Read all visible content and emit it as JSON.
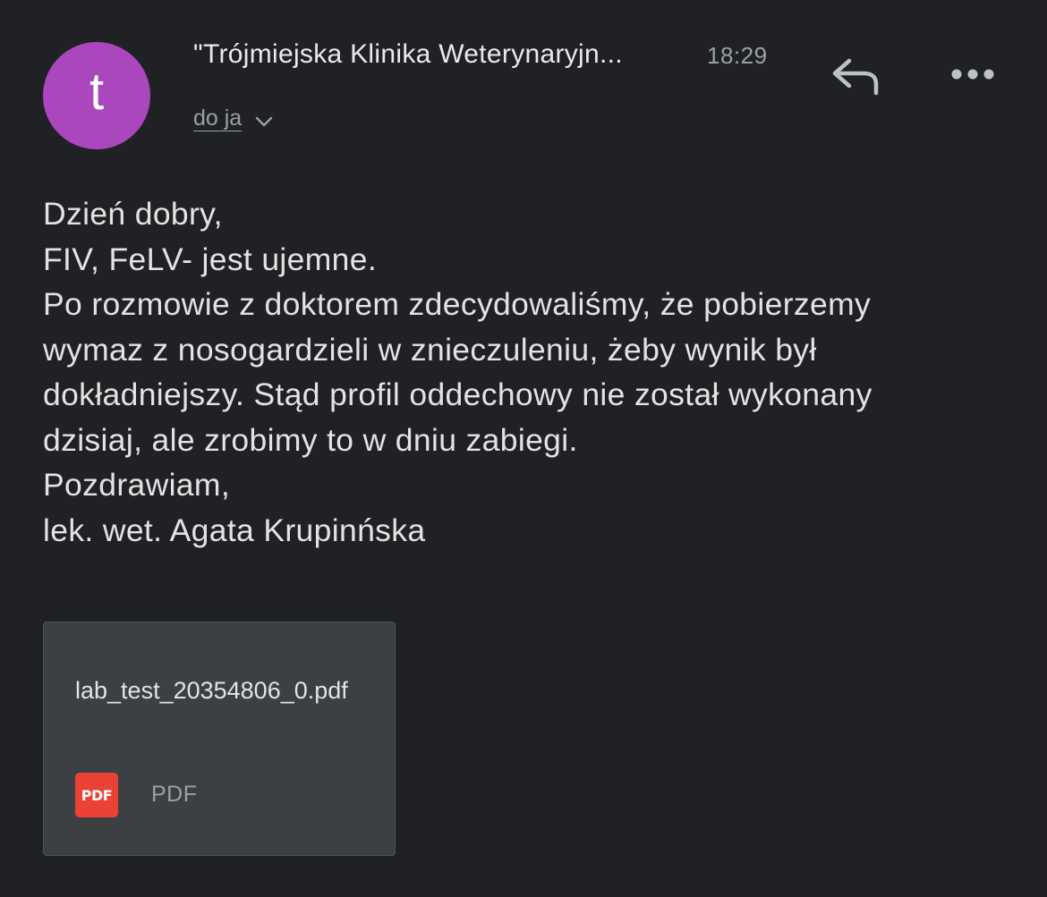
{
  "email": {
    "avatar_letter": "t",
    "avatar_color": "#ab47bc",
    "sender": "\"Trójmiejska Klinika Weterynaryjn...",
    "time": "18:29",
    "recipient": "do ja",
    "actions": {
      "reply_icon": "reply-icon",
      "more_icon": "more-horizontal-icon"
    },
    "body_lines": [
      "Dzień dobry,",
      "FIV, FeLV- jest ujemne.",
      "Po rozmowie z doktorem zdecydowaliśmy, że pobierzemy",
      "wymaz z nosogardzieli w znieczuleniu, żeby wynik był",
      "dokładniejszy. Stąd profil oddechowy nie został wykonany",
      "dzisiaj, ale zrobimy to w dniu zabiegi.",
      "Pozdrawiam,",
      "lek. wet. Agata Krupinńska"
    ],
    "attachment": {
      "filename": "lab_test_20354806_0.pdf",
      "icon_text": "PDF",
      "type_label": "PDF",
      "icon_color": "#ea4335"
    }
  }
}
